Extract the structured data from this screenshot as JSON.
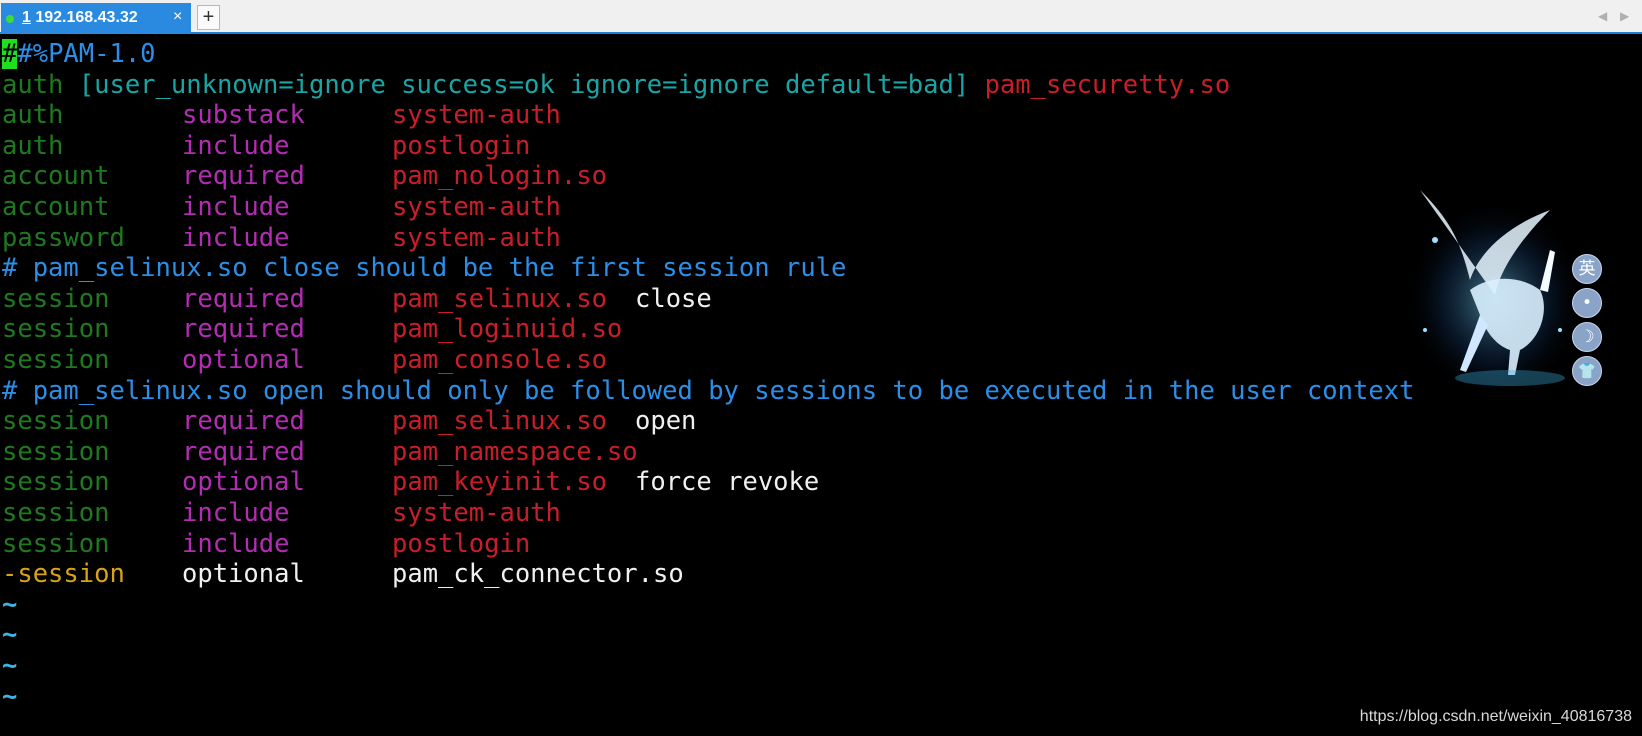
{
  "tab": {
    "number": "1",
    "host": "192.168.43.32",
    "close": "×"
  },
  "newtab": "+",
  "nav": {
    "left": "◀",
    "right": "▶"
  },
  "lines": [
    [
      "#%PAM-1.0"
    ],
    [
      "auth",
      " [user_unknown=ignore success=ok ignore=ignore default=bad] ",
      "pam_securetty.so"
    ],
    [
      "auth",
      "substack",
      "system-auth"
    ],
    [
      "auth",
      "include",
      "postlogin"
    ],
    [
      "account",
      "required",
      "pam_nologin.so"
    ],
    [
      "account",
      "include",
      "system-auth"
    ],
    [
      "password",
      "include",
      "system-auth"
    ],
    [
      "# pam_selinux.so close should be the first session rule"
    ],
    [
      "session",
      "required",
      "pam_selinux.so",
      "close"
    ],
    [
      "session",
      "required",
      "pam_loginuid.so"
    ],
    [
      "session",
      "optional",
      "pam_console.so"
    ],
    [
      "# pam_selinux.so open should only be followed by sessions to be executed in the user context"
    ],
    [
      "session",
      "required",
      "pam_selinux.so",
      "open"
    ],
    [
      "session",
      "required",
      "pam_namespace.so"
    ],
    [
      "session",
      "optional",
      "pam_keyinit.so",
      "force revoke"
    ],
    [
      "session",
      "include",
      "system-auth"
    ],
    [
      "session",
      "include",
      "postlogin"
    ],
    [
      "-session",
      "optional",
      "pam_ck_connector.so"
    ],
    [
      "~"
    ],
    [
      "~"
    ],
    [
      "~"
    ],
    [
      "~"
    ]
  ],
  "ime": {
    "lang": "英",
    "btn2": "•",
    "btn3": "☽",
    "btn4": "👕"
  },
  "watermark": "https://blog.csdn.net/weixin_40816738",
  "colors": {
    "accent": "#2a8ae0",
    "cursor": "#1ee01e",
    "green": "#1f7a1f",
    "magenta": "#b42bb4",
    "red": "#c81e2a",
    "blue": "#2b8fe8",
    "yellow": "#d9a21a"
  }
}
